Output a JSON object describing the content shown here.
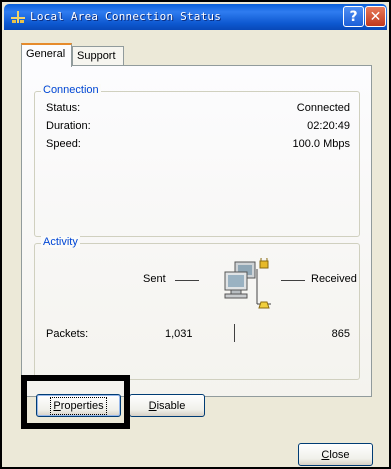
{
  "window": {
    "title": "Local Area Connection Status",
    "help_button": "?",
    "close_button": "✕"
  },
  "tabs": [
    {
      "label": "General",
      "active": true
    },
    {
      "label": "Support",
      "active": false
    }
  ],
  "connection": {
    "group_label": "Connection",
    "rows": [
      {
        "label": "Status:",
        "value": "Connected"
      },
      {
        "label": "Duration:",
        "value": "02:20:49"
      },
      {
        "label": "Speed:",
        "value": "100.0 Mbps"
      }
    ]
  },
  "activity": {
    "group_label": "Activity",
    "sent_label": "Sent",
    "received_label": "Received",
    "packets_label": "Packets:",
    "packets_sent": "1,031",
    "packets_received": "865",
    "icon": "network-activity-icon"
  },
  "buttons": {
    "properties": {
      "underlined": "P",
      "rest": "roperties"
    },
    "disable": {
      "underlined": "D",
      "rest": "isable"
    },
    "close": {
      "underlined": "C",
      "rest": "lose"
    }
  },
  "colors": {
    "title_bar": "#0a5fd8",
    "group_label": "#0046d5",
    "active_tab_accent": "#e68b2c",
    "annotation_box": "#000000"
  }
}
